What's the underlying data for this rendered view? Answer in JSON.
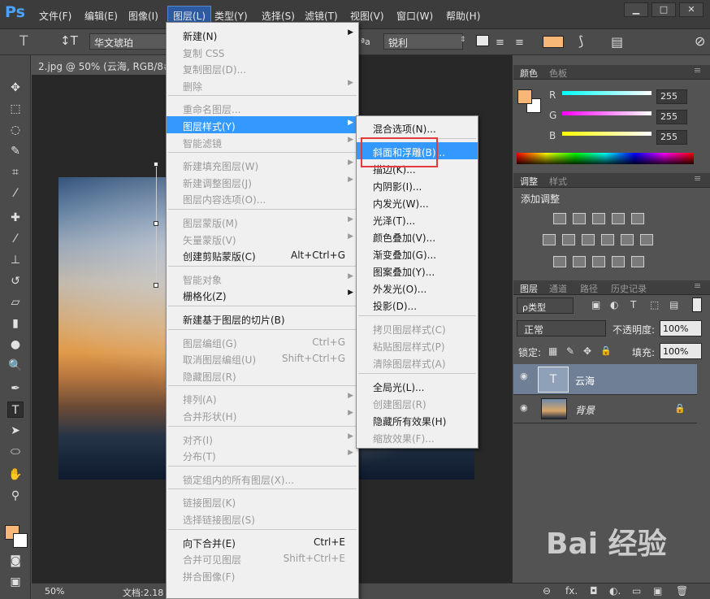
{
  "app": {
    "logo": "Ps"
  },
  "menubar": {
    "items": [
      "文件(F)",
      "编辑(E)",
      "图像(I)",
      "图层(L)",
      "类型(Y)",
      "选择(S)",
      "滤镜(T)",
      "视图(V)",
      "窗口(W)",
      "帮助(H)"
    ],
    "active_index": 3
  },
  "window_buttons": [
    "▁",
    "□",
    "✕"
  ],
  "options_bar": {
    "font_family": "华文琥珀",
    "antialias_label": "ªa",
    "antialias": "锐利",
    "text_color": "#f7b877"
  },
  "document": {
    "tab_title": "2.jpg @ 50% (云海, RGB/8#)",
    "zoom": "50%",
    "doc_info": "文档:2.18"
  },
  "layer_menu": {
    "items": [
      {
        "label": "新建(N)",
        "disabled": false,
        "submenu": true
      },
      {
        "label": "复制 CSS",
        "disabled": true
      },
      {
        "label": "复制图层(D)...",
        "disabled": true
      },
      {
        "label": "删除",
        "disabled": true,
        "submenu": true
      },
      {
        "sep": true
      },
      {
        "label": "重命名图层...",
        "disabled": true
      },
      {
        "label": "图层样式(Y)",
        "disabled": false,
        "submenu": true,
        "highlight": true
      },
      {
        "label": "智能滤镜",
        "disabled": true,
        "submenu": true
      },
      {
        "sep": true
      },
      {
        "label": "新建填充图层(W)",
        "disabled": true,
        "submenu": true
      },
      {
        "label": "新建调整图层(J)",
        "disabled": true,
        "submenu": true
      },
      {
        "label": "图层内容选项(O)...",
        "disabled": true
      },
      {
        "sep": true
      },
      {
        "label": "图层蒙版(M)",
        "disabled": true,
        "submenu": true
      },
      {
        "label": "矢量蒙版(V)",
        "disabled": true,
        "submenu": true
      },
      {
        "label": "创建剪贴蒙版(C)",
        "disabled": false,
        "shortcut": "Alt+Ctrl+G"
      },
      {
        "sep": true
      },
      {
        "label": "智能对象",
        "disabled": true,
        "submenu": true
      },
      {
        "label": "栅格化(Z)",
        "disabled": false,
        "submenu": true
      },
      {
        "sep": true
      },
      {
        "label": "新建基于图层的切片(B)",
        "disabled": false
      },
      {
        "sep": true
      },
      {
        "label": "图层编组(G)",
        "disabled": true,
        "shortcut": "Ctrl+G"
      },
      {
        "label": "取消图层编组(U)",
        "disabled": true,
        "shortcut": "Shift+Ctrl+G"
      },
      {
        "label": "隐藏图层(R)",
        "disabled": true
      },
      {
        "sep": true
      },
      {
        "label": "排列(A)",
        "disabled": true,
        "submenu": true
      },
      {
        "label": "合并形状(H)",
        "disabled": true,
        "submenu": true
      },
      {
        "sep": true
      },
      {
        "label": "对齐(I)",
        "disabled": true,
        "submenu": true
      },
      {
        "label": "分布(T)",
        "disabled": true,
        "submenu": true
      },
      {
        "sep": true
      },
      {
        "label": "锁定组内的所有图层(X)...",
        "disabled": true
      },
      {
        "sep": true
      },
      {
        "label": "链接图层(K)",
        "disabled": true
      },
      {
        "label": "选择链接图层(S)",
        "disabled": true
      },
      {
        "sep": true
      },
      {
        "label": "向下合并(E)",
        "disabled": false,
        "shortcut": "Ctrl+E"
      },
      {
        "label": "合并可见图层",
        "disabled": true,
        "shortcut": "Shift+Ctrl+E"
      },
      {
        "label": "拼合图像(F)",
        "disabled": true
      }
    ]
  },
  "style_submenu": {
    "items": [
      {
        "label": "混合选项(N)...",
        "disabled": false
      },
      {
        "sep": true
      },
      {
        "label": "斜面和浮雕(B)...",
        "disabled": false,
        "highlight": true
      },
      {
        "label": "描边(K)...",
        "disabled": false
      },
      {
        "label": "内阴影(I)...",
        "disabled": false
      },
      {
        "label": "内发光(W)...",
        "disabled": false
      },
      {
        "label": "光泽(T)...",
        "disabled": false
      },
      {
        "label": "颜色叠加(V)...",
        "disabled": false
      },
      {
        "label": "渐变叠加(G)...",
        "disabled": false
      },
      {
        "label": "图案叠加(Y)...",
        "disabled": false
      },
      {
        "label": "外发光(O)...",
        "disabled": false
      },
      {
        "label": "投影(D)...",
        "disabled": false
      },
      {
        "sep": true
      },
      {
        "label": "拷贝图层样式(C)",
        "disabled": true
      },
      {
        "label": "粘贴图层样式(P)",
        "disabled": true
      },
      {
        "label": "清除图层样式(A)",
        "disabled": true
      },
      {
        "sep": true
      },
      {
        "label": "全局光(L)...",
        "disabled": false
      },
      {
        "label": "创建图层(R)",
        "disabled": true
      },
      {
        "label": "隐藏所有效果(H)",
        "disabled": false
      },
      {
        "label": "缩放效果(F)...",
        "disabled": true
      }
    ]
  },
  "color_panel": {
    "tabs": [
      "颜色",
      "色板"
    ],
    "channels": [
      {
        "name": "R",
        "value": "255",
        "color": "#00ffff"
      },
      {
        "name": "G",
        "value": "255",
        "color": "#ff00ff"
      },
      {
        "name": "B",
        "value": "255",
        "color": "#ffff00"
      }
    ],
    "fg_color": "#f7b877"
  },
  "adjust_panel": {
    "tabs": [
      "调整",
      "样式"
    ],
    "title": "添加调整"
  },
  "layers_panel": {
    "tabs": [
      "图层",
      "通道",
      "路径",
      "历史记录"
    ],
    "filter": "ρ类型",
    "filter_icons": [
      "▣",
      "◐",
      "T",
      "⬚",
      "▤"
    ],
    "blend_mode": "正常",
    "opacity_label": "不透明度:",
    "opacity": "100%",
    "lock_label": "锁定:",
    "lock_icons": [
      "▦",
      "✎",
      "✥",
      "🔒"
    ],
    "fill_label": "填充:",
    "fill": "100%",
    "layers": [
      {
        "name": "云海",
        "selected": true,
        "thumb_glyph": "T"
      },
      {
        "name": "背景",
        "selected": false,
        "locked": true
      }
    ],
    "footer_icons": [
      "⊖",
      "fx.",
      "◘",
      "◐.",
      "▭",
      "▣",
      "🗑"
    ]
  },
  "watermark": "Bai  经验"
}
